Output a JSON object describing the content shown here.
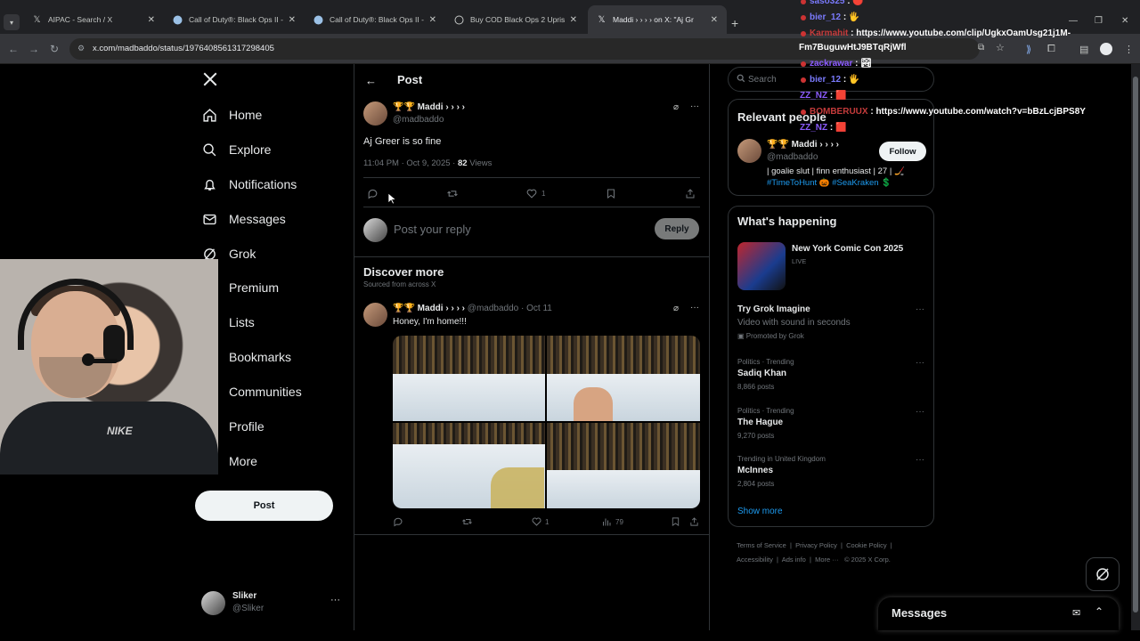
{
  "browser": {
    "tabs": [
      {
        "title": "AIPAC - Search / X",
        "icon": "x-logo"
      },
      {
        "title": "Call of Duty®: Black Ops II - Ap",
        "icon": "steam-icon"
      },
      {
        "title": "Call of Duty®: Black Ops II - Up",
        "icon": "steam-icon"
      },
      {
        "title": "Buy COD Black Ops 2 Uprising",
        "icon": "globe-icon"
      },
      {
        "title": "Maddi › › › › on X: \"Aj Gr",
        "icon": "x-logo"
      }
    ],
    "url": "x.com/madbaddo/status/1976408561317298405"
  },
  "nav": {
    "items": [
      {
        "label": "Home",
        "icon": "home-icon"
      },
      {
        "label": "Explore",
        "icon": "search-icon"
      },
      {
        "label": "Notifications",
        "icon": "bell-icon"
      },
      {
        "label": "Messages",
        "icon": "mail-icon"
      },
      {
        "label": "Grok",
        "icon": "grok-icon"
      },
      {
        "label": "Premium",
        "icon": "x-icon"
      },
      {
        "label": "Lists",
        "icon": "list-icon"
      },
      {
        "label": "Bookmarks",
        "icon": "bookmark-icon"
      },
      {
        "label": "Communities",
        "icon": "people-icon"
      },
      {
        "label": "Profile",
        "icon": "person-icon"
      },
      {
        "label": "More",
        "icon": "more-icon"
      }
    ],
    "post_button": "Post",
    "account": {
      "name": "Sliker",
      "handle": "@Sliker"
    }
  },
  "header": {
    "title": "Post"
  },
  "post": {
    "author": "🏆🏆 Maddi › › › ›",
    "handle": "@madbaddo",
    "text": "Aj Greer is so fine",
    "time": "11:04 PM · Oct 9, 2025 ·",
    "views_count": "82",
    "views_label": "Views",
    "likes": "1"
  },
  "reply": {
    "placeholder": "Post your reply",
    "button": "Reply"
  },
  "discover": {
    "title": "Discover more",
    "subtitle": "Sourced from across X",
    "post": {
      "author": "🏆🏆 Maddi › › › ›",
      "handle": "@madbaddo",
      "date": "· Oct 11",
      "text": "Honey, I'm home!!!",
      "likes": "1",
      "views": "79"
    }
  },
  "search": {
    "placeholder": "Search"
  },
  "relevant": {
    "title": "Relevant people",
    "name": "🏆🏆 Maddi › › › ›",
    "handle": "@madbaddo",
    "follow": "Follow",
    "bio": "| goalie slut | finn enthusiast | 27 | 🏒",
    "tags": "#TimeToHunt 🎃 #SeaKraken 💲"
  },
  "happening": {
    "title": "What's happening",
    "event": {
      "name": "New York Comic Con 2025",
      "status": "LIVE"
    },
    "promo": {
      "title": "Try Grok Imagine",
      "desc": "Video with sound in seconds",
      "by": "Promoted by Grok"
    },
    "trends": [
      {
        "context": "Politics · Trending",
        "name": "Sadiq Khan",
        "posts": "8,866 posts"
      },
      {
        "context": "Politics · Trending",
        "name": "The Hague",
        "posts": "9,270 posts"
      },
      {
        "context": "Trending in United Kingdom",
        "name": "McInnes",
        "posts": "2,804 posts"
      }
    ],
    "show_more": "Show more"
  },
  "footer": {
    "links": [
      "Terms of Service",
      "Privacy Policy",
      "Cookie Policy",
      "Accessibility",
      "Ads info",
      "More ···"
    ],
    "copyright": "© 2025 X Corp."
  },
  "messages_bar": {
    "title": "Messages"
  },
  "chat": [
    {
      "user": "saso325",
      "color": "#7a7afc",
      "msg": ""
    },
    {
      "user": "bier_12",
      "color": "#7a7afc",
      "msg": ""
    },
    {
      "user": "Karmahit",
      "color": "#c43b3b",
      "msg": "https://www.youtube.com/clip/UgkxOamUsg21j1M-"
    },
    {
      "user": "",
      "color": "#ffffff",
      "msg": "Fm7BuguwHtJ9BTqRjWfl"
    },
    {
      "user": "zackrawar",
      "color": "#8c5cff",
      "msg": ""
    },
    {
      "user": "bier_12",
      "color": "#7a7afc",
      "msg": ""
    },
    {
      "user": "ZZ_NZ",
      "color": "#8c5cff",
      "msg": ""
    },
    {
      "user": "BOMBERUUX",
      "color": "#c43b3b",
      "msg": "https://www.youtube.com/watch?v=bBzLcjBPS8Y"
    },
    {
      "user": "ZZ_NZ",
      "color": "#8c5cff",
      "msg": ""
    }
  ]
}
